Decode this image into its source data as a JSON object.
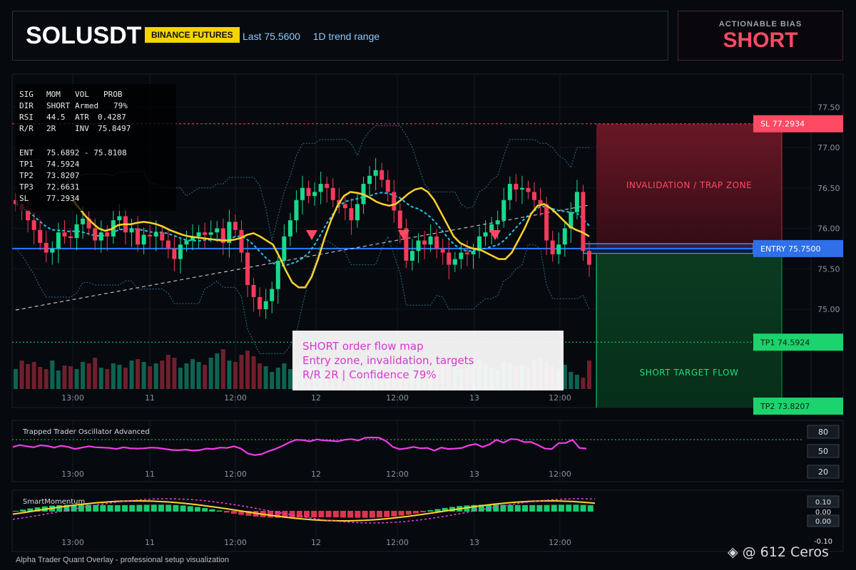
{
  "header": {
    "symbol": "SOLUSDT",
    "exchange": "BINANCE FUTURES",
    "last": "Last 75.5600",
    "range": "1D trend range"
  },
  "bias": {
    "label": "ACTIONABLE BIAS",
    "value": "SHORT"
  },
  "stats": {
    "head": [
      "SIG",
      "MOM",
      "VOL",
      "PROB"
    ],
    "rows": [
      [
        "DIR",
        "SHORT",
        "Armed",
        "79%"
      ],
      [
        "RSI",
        "44.5",
        "ATR",
        "0.4287"
      ],
      [
        "R/R",
        "2R",
        "INV",
        "75.8497"
      ]
    ],
    "levels": [
      [
        "ENT",
        "75.6892 - 75.8108"
      ],
      [
        "TP1",
        "74.5924"
      ],
      [
        "TP2",
        "73.8207"
      ],
      [
        "TP3",
        "72.6631"
      ],
      [
        "SL",
        "77.2934"
      ]
    ]
  },
  "zones": {
    "invalidation": "INVALIDATION / TRAP ZONE",
    "target": "SHORT TARGET FLOW"
  },
  "tags": {
    "sl": "SL 77.2934",
    "entry": "ENTRY 75.7500",
    "tp1": "TP1 74.5924",
    "tp2": "TP2 73.8207"
  },
  "caption": {
    "line1": "SHORT order flow map",
    "line2": "Entry zone, invalidation, targets",
    "line3": "R/R 2R | Confidence 79%"
  },
  "osc": {
    "title": "Trapped Trader Oscillator Advanced",
    "levels": [
      "80",
      "50",
      "20"
    ]
  },
  "mom": {
    "title": "SmartMomentum",
    "levels": [
      "0.10",
      "0.00",
      "0.00",
      "-0.10"
    ]
  },
  "footer": "Alpha Trader Quant Overlay - professional setup visualization",
  "watermark": "@ 612 Ceros",
  "colors": {
    "up": "#19d98c",
    "down": "#f23b5a",
    "entry": "#2b7bff",
    "ma": "#ffd42a",
    "osc": "#ee3ee6",
    "sl": "#ff4a64",
    "tp": "#1ee07a"
  },
  "chart_data": {
    "type": "candlestick",
    "x_ticks": [
      "13:00",
      "11",
      "12:00",
      "12",
      "12:00",
      "13",
      "12:00"
    ],
    "y_ticks": [
      77.5,
      77.0,
      76.5,
      76.0,
      75.5,
      75.0
    ],
    "ylim": [
      74.3,
      77.8
    ],
    "levels": {
      "sl": 77.2934,
      "entry": 75.75,
      "entry_zone": [
        75.6892,
        75.8108
      ],
      "tp1": 74.5924,
      "tp2": 73.8207,
      "last": 75.56
    },
    "closes": [
      76.3,
      76.22,
      76.1,
      75.98,
      75.82,
      75.7,
      75.75,
      75.95,
      75.9,
      75.88,
      76.05,
      76.12,
      76.0,
      75.85,
      75.95,
      75.9,
      76.1,
      76.15,
      75.95,
      76.0,
      75.8,
      75.92,
      75.9,
      75.95,
      75.85,
      75.75,
      75.62,
      75.8,
      75.85,
      75.9,
      75.95,
      75.92,
      75.95,
      76.0,
      75.82,
      76.08,
      75.98,
      75.7,
      75.3,
      75.15,
      75.0,
      75.1,
      75.25,
      75.6,
      75.9,
      76.1,
      76.35,
      76.5,
      76.4,
      76.45,
      76.55,
      76.5,
      76.35,
      76.3,
      76.25,
      76.1,
      76.3,
      76.55,
      76.65,
      76.72,
      76.6,
      76.45,
      76.22,
      76.0,
      75.6,
      75.72,
      75.85,
      75.8,
      75.9,
      75.75,
      75.7,
      75.55,
      75.62,
      75.7,
      75.68,
      75.72,
      75.9,
      75.95,
      76.05,
      76.1,
      76.35,
      76.55,
      76.48,
      76.5,
      76.45,
      76.35,
      76.3,
      75.85,
      75.68,
      75.8,
      76.0,
      76.2,
      76.45,
      75.72,
      75.55
    ],
    "ma": {
      "name": "",
      "values": [
        76.35,
        76.25,
        76.15,
        76.07,
        76.0,
        75.97,
        75.99,
        76.04,
        76.05,
        76.05,
        76.07,
        76.08,
        76.07,
        76.05,
        76.02,
        75.98,
        75.95,
        75.92,
        75.9,
        75.89,
        75.88,
        75.87,
        75.86,
        75.85,
        75.85,
        75.86,
        75.88,
        75.92,
        75.94,
        75.9,
        75.85,
        75.8,
        75.65,
        75.48,
        75.33,
        75.27,
        75.27,
        75.4,
        75.62,
        75.88,
        76.1,
        76.28,
        76.4,
        76.45,
        76.44,
        76.42,
        76.38,
        76.33,
        76.3,
        76.28,
        76.3,
        76.36,
        76.43,
        76.48,
        76.5,
        76.45,
        76.35,
        76.2,
        76.05,
        75.9,
        75.82,
        75.78,
        75.75,
        75.74,
        75.7,
        75.66,
        75.62,
        75.62,
        75.7,
        75.85,
        76.0,
        76.18,
        76.28,
        76.3,
        76.25,
        76.18,
        76.1,
        76.02,
        75.98,
        75.95,
        75.9
      ]
    },
    "markers": [
      "short-signal",
      "short-signal",
      "short-signal"
    ],
    "oscillator": {
      "name": "Trapped Trader Oscillator Advanced",
      "values": [
        58,
        64,
        60,
        57,
        63,
        61,
        56,
        62,
        58,
        52,
        56,
        60,
        57,
        56,
        55,
        52,
        57,
        54,
        53,
        54,
        56,
        55,
        52,
        49,
        48,
        50,
        47,
        48,
        53,
        52,
        56,
        55,
        60,
        53,
        38,
        33,
        36,
        45,
        52,
        61,
        72,
        80,
        79,
        75,
        81,
        78,
        77,
        75,
        80,
        82,
        78,
        86,
        87,
        86,
        76,
        58,
        51,
        54,
        58,
        54,
        55,
        47,
        56,
        52,
        53,
        55,
        63,
        67,
        58,
        66,
        80,
        71,
        82,
        81,
        73,
        73,
        64,
        53,
        52,
        70,
        70,
        80,
        55,
        53
      ],
      "levels": [
        80,
        50,
        20
      ]
    },
    "momentum": {
      "name": "SmartMomentum",
      "ylim": [
        -0.12,
        0.12
      ],
      "levels": [
        0.1,
        0.0,
        -0.1
      ]
    }
  }
}
